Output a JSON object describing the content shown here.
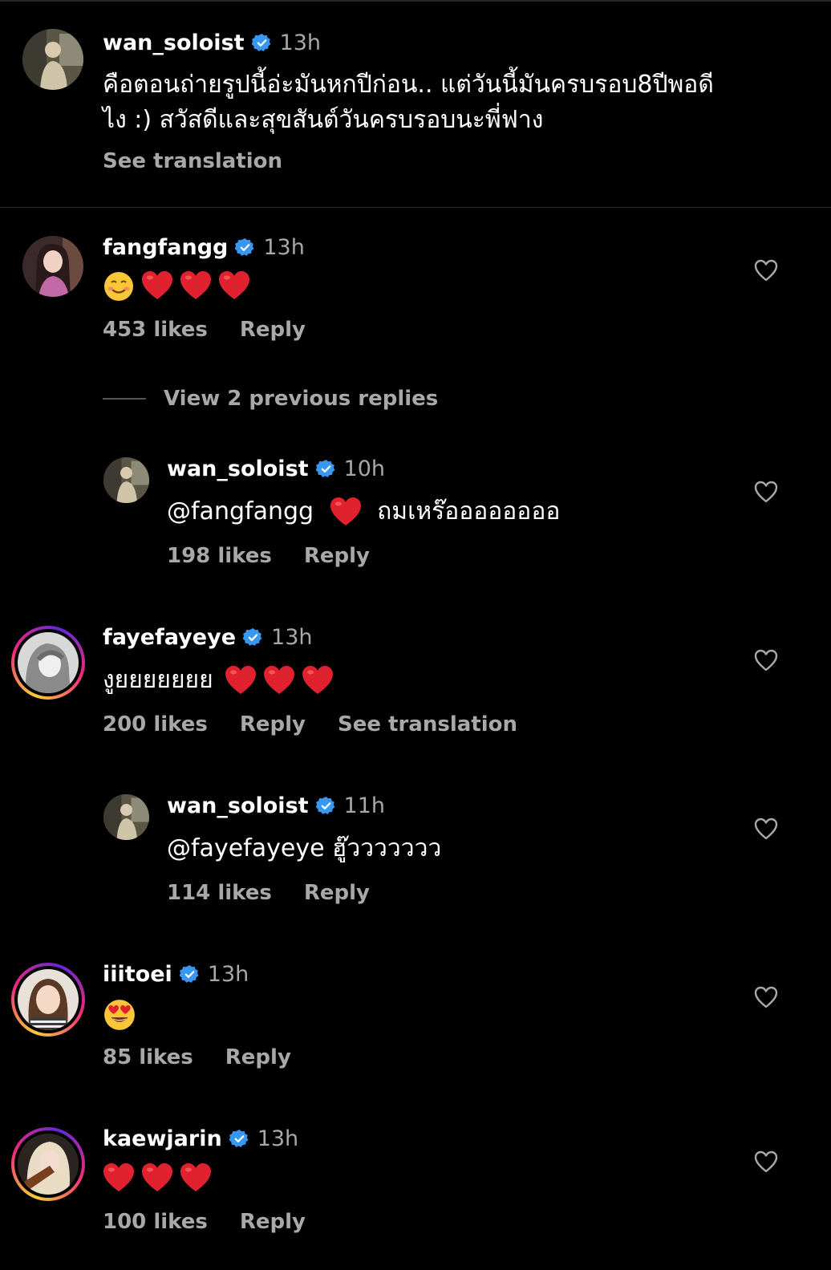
{
  "caption_post": {
    "username": "wan_soloist",
    "time": "13h",
    "text_line1": "คือตอนถ่ายรูปนี้อ่ะมันหกปีก่อน.. แต่วันนี้มันครบรอบ8ปีพอดี",
    "text_line2": "ไง :) สวัสดีและสุขสันต์วันครบรอบนะพี่ฟาง",
    "see_translation": "See translation"
  },
  "comments": [
    {
      "username": "fangfangg",
      "time": "13h",
      "emoji": [
        "smiling-face-icon",
        "red-heart-icon",
        "red-heart-icon",
        "red-heart-icon"
      ],
      "likes": "453 likes",
      "reply": "Reply"
    },
    {
      "view_replies": "View 2 previous replies"
    },
    {
      "username": "wan_soloist",
      "time": "10h",
      "mention": "@fangfangg",
      "text_after": "ถมเหร๊ออออออออ",
      "likes": "198 likes",
      "reply": "Reply"
    },
    {
      "username": "fayefayeye",
      "time": "13h",
      "text": "งูยยยยยยย",
      "likes": "200 likes",
      "reply": "Reply",
      "see_translation": "See translation"
    },
    {
      "username": "wan_soloist",
      "time": "11h",
      "text": "@fayefayeye ฮู๊ววววววว",
      "likes": "114 likes",
      "reply": "Reply"
    },
    {
      "username": "iiitoei",
      "time": "13h",
      "emoji": [
        "heart-eyes-icon"
      ],
      "likes": "85 likes",
      "reply": "Reply"
    },
    {
      "username": "kaewjarin",
      "time": "13h",
      "emoji": [
        "red-heart-icon",
        "red-heart-icon",
        "red-heart-icon"
      ],
      "likes": "100 likes",
      "reply": "Reply"
    }
  ],
  "colors": {
    "background": "#000000",
    "secondary_text": "#a8a8a8",
    "verified_blue": "#3897f0",
    "heart_red": "#e0222f"
  }
}
